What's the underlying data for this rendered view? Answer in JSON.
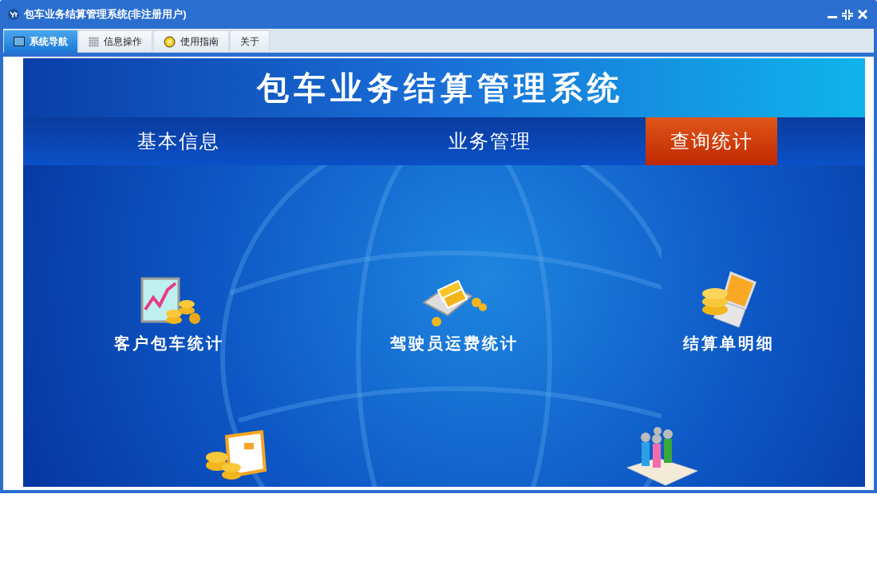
{
  "window": {
    "title": "包车业务结算管理系统(非注册用户)"
  },
  "tabs": [
    {
      "label": "系统导航",
      "selected": true,
      "kind": "monitor"
    },
    {
      "label": "信息操作",
      "selected": false,
      "kind": "grid"
    },
    {
      "label": "使用指南",
      "selected": false,
      "kind": "help"
    },
    {
      "label": "关于",
      "selected": false,
      "kind": "none"
    }
  ],
  "banner": {
    "title": "包车业务结算管理系统"
  },
  "nav": [
    {
      "label": "基本信息",
      "selected": false
    },
    {
      "label": "业务管理",
      "selected": false
    },
    {
      "label": "查询统计",
      "selected": true
    }
  ],
  "tiles": [
    {
      "kind": "chart",
      "label": "客户包车统计"
    },
    {
      "kind": "cash",
      "label": "驾驶员运费统计"
    },
    {
      "kind": "laptop",
      "label": "结算单明细"
    },
    {
      "kind": "invoice"
    },
    {
      "kind": "people"
    }
  ]
}
